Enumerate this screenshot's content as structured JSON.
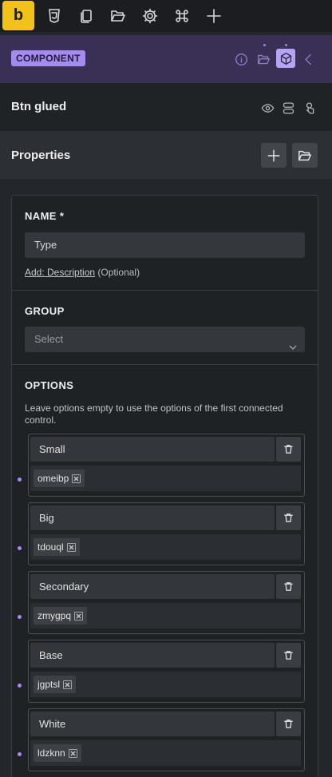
{
  "topbar": {
    "logo_letter": "b",
    "icons": [
      "css3-icon",
      "pages-icon",
      "folder-open-icon",
      "gear-icon",
      "command-icon",
      "plus-icon"
    ]
  },
  "component_bar": {
    "badge": "COMPONENT",
    "icons": [
      "info-icon",
      "folder-icon",
      "cube-icon",
      "chevron-left-icon"
    ],
    "accent_color": "#a58bf0"
  },
  "element": {
    "title": "Btn glued",
    "icons": [
      "eye-icon",
      "stack-icon",
      "pointer-icon"
    ]
  },
  "properties": {
    "title": "Properties",
    "add_icon": "plus-icon",
    "folder_icon": "folder-open-icon"
  },
  "form": {
    "name_label": "NAME *",
    "name_value": "Type",
    "desc_link": "Add: Description",
    "desc_optional": "(Optional)",
    "group_label": "GROUP",
    "group_placeholder": "Select",
    "options_label": "OPTIONS",
    "options_help": "Leave options empty to use the options of the first connected control."
  },
  "options": [
    {
      "label": "Small",
      "id": "omeibp"
    },
    {
      "label": "Big",
      "id": "tdouql"
    },
    {
      "label": "Secondary",
      "id": "zmygpq"
    },
    {
      "label": "Base",
      "id": "jgptsl"
    },
    {
      "label": "White",
      "id": "ldzknn"
    }
  ]
}
